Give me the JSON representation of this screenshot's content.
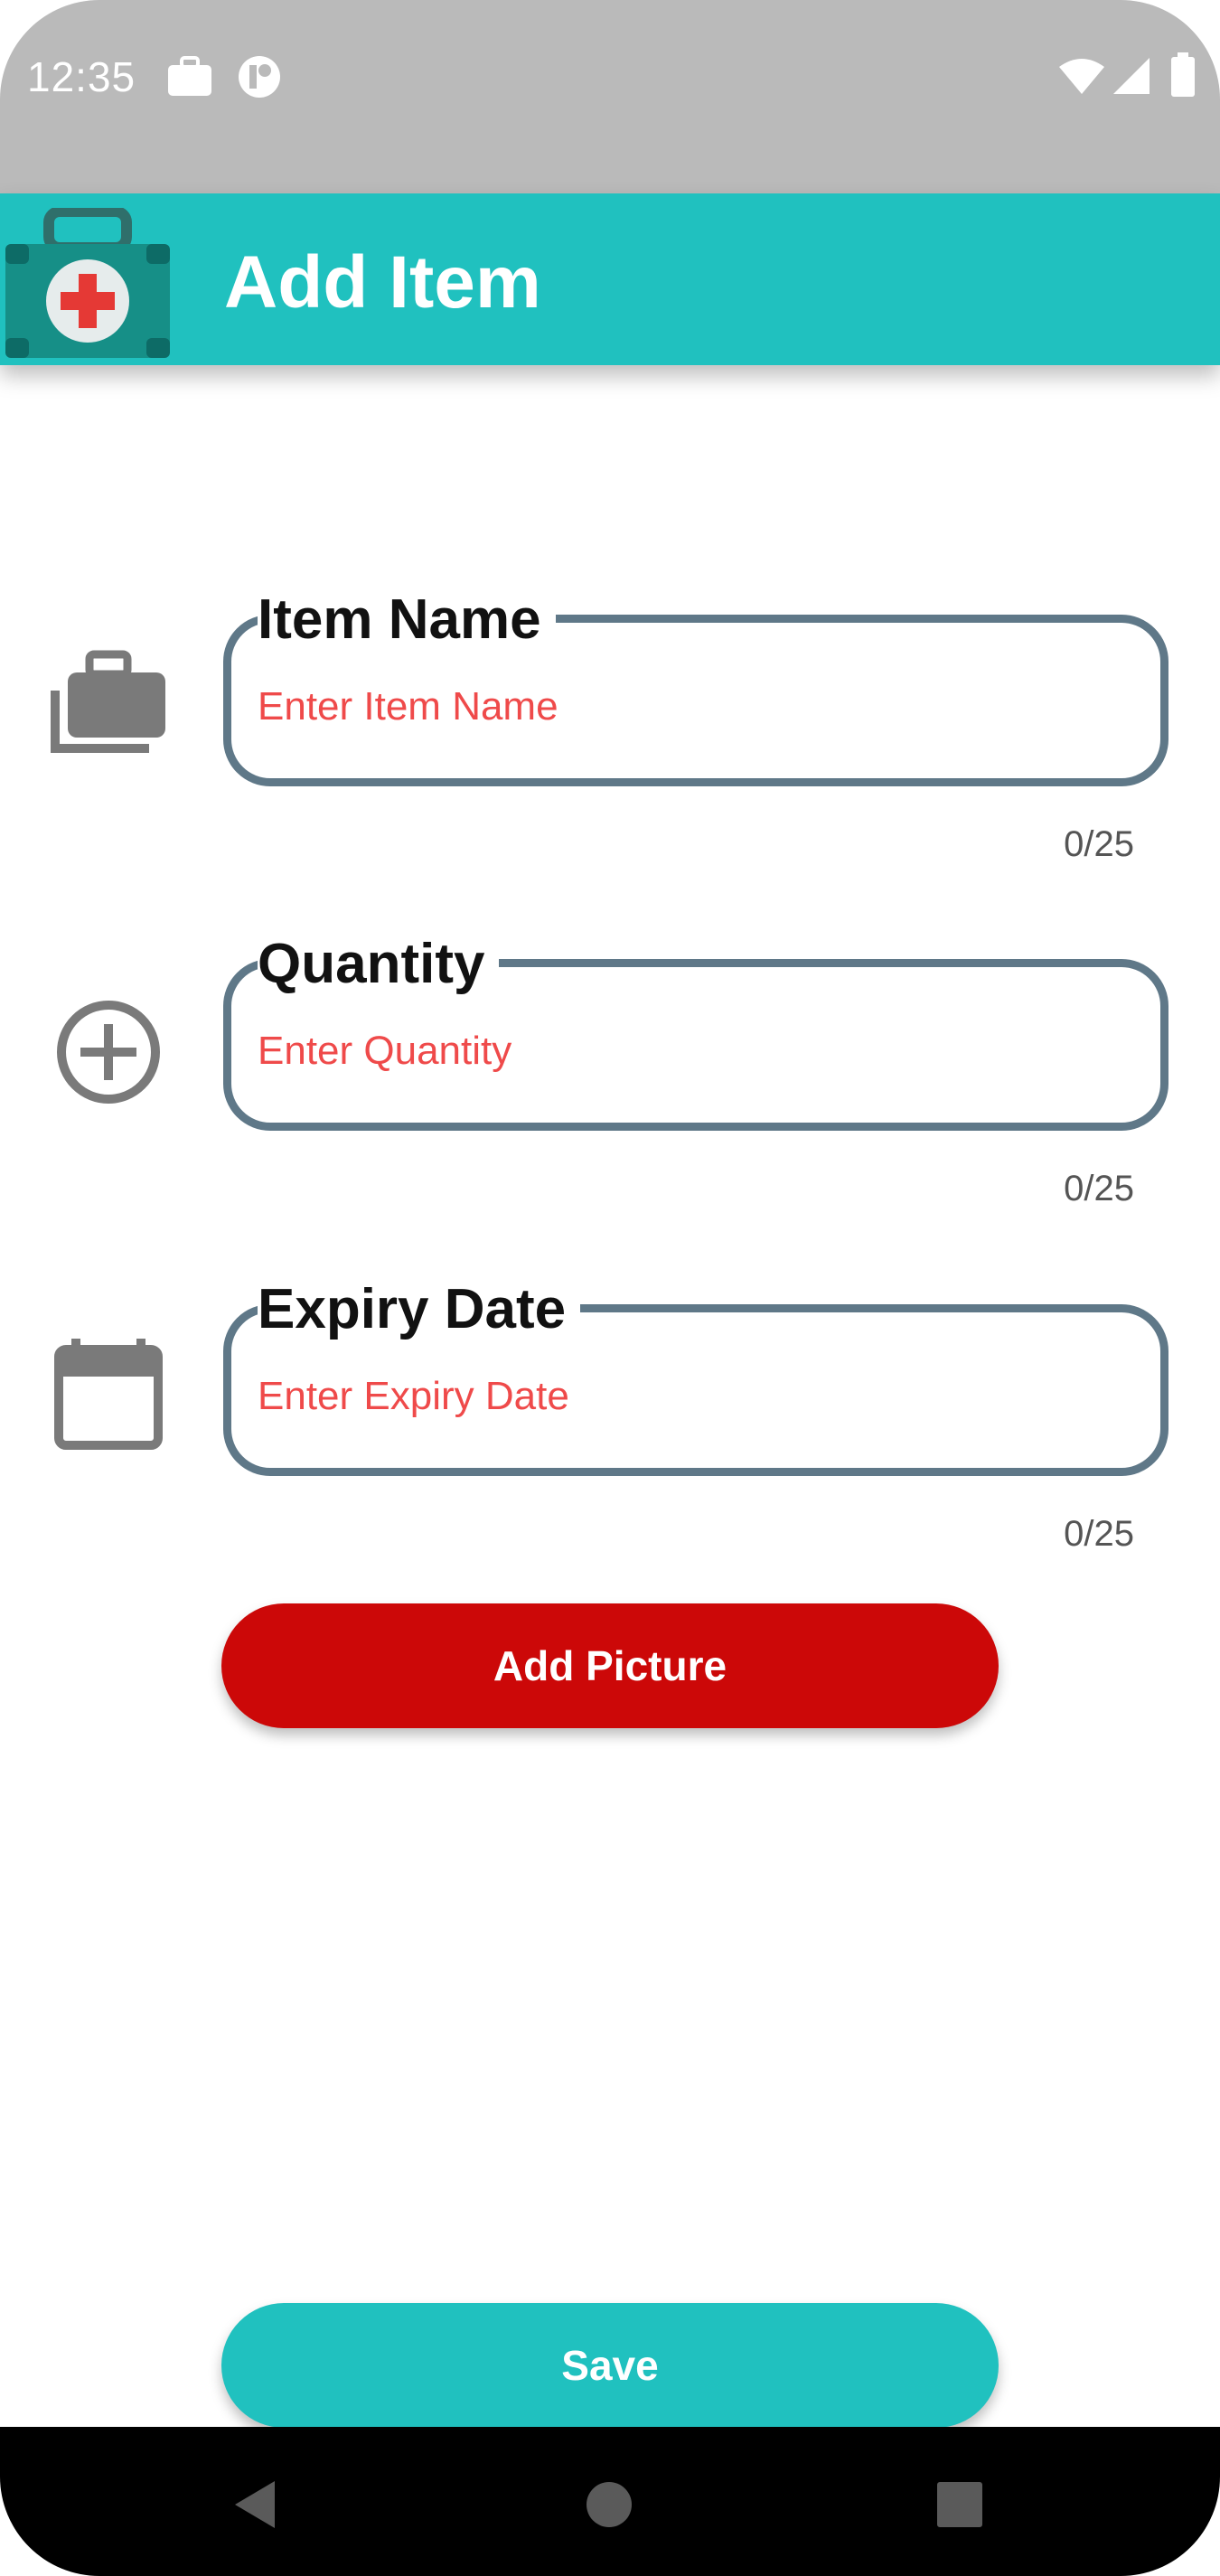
{
  "status_bar": {
    "time": "12:35",
    "icons": [
      "briefcase-icon",
      "app-notification-icon",
      "wifi-icon",
      "signal-icon",
      "battery-icon"
    ]
  },
  "app_bar": {
    "title": "Add Item",
    "logo": "first-aid-kit-icon",
    "color": "#20c1bf"
  },
  "form": {
    "fields": [
      {
        "label": "Item Name",
        "placeholder": "Enter Item Name",
        "value": "",
        "counter": "0/25",
        "icon": "briefcase-icon"
      },
      {
        "label": "Quantity",
        "placeholder": "Enter Quantity",
        "value": "",
        "counter": "0/25",
        "icon": "add-circle-icon"
      },
      {
        "label": "Expiry Date",
        "placeholder": "Enter Expiry Date",
        "value": "",
        "counter": "0/25",
        "icon": "calendar-icon"
      }
    ]
  },
  "buttons": {
    "add_picture": "Add Picture",
    "save": "Save"
  },
  "nav_bar": {
    "icons": [
      "back-icon",
      "home-icon",
      "recents-icon"
    ]
  },
  "colors": {
    "accent": "#20c1bf",
    "danger": "#cc0808",
    "placeholder": "#ef4a4a",
    "field_border": "#5f7888"
  }
}
